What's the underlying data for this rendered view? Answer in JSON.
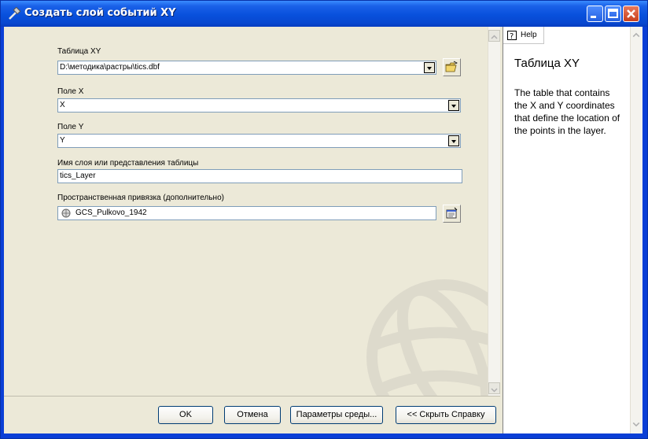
{
  "window": {
    "title": "Создать слой событий  XY"
  },
  "fields": {
    "table_xy": {
      "label": "Таблица XY",
      "value": "D:\\методика\\растры\\tics.dbf"
    },
    "field_x": {
      "label": "Поле X",
      "value": "X"
    },
    "field_y": {
      "label": "Поле Y",
      "value": "Y"
    },
    "layer_name": {
      "label": "Имя слоя или представления таблицы",
      "value": "tics_Layer"
    },
    "spatial_ref": {
      "label": "Пространственная привязка (дополнительно)",
      "value": "GCS_Pulkovo_1942"
    }
  },
  "buttons": {
    "ok": "OK",
    "cancel": "Отмена",
    "env": "Параметры среды...",
    "hide_help": "<< Скрыть Справку"
  },
  "help": {
    "tab_label": "Help",
    "title": "Таблица XY",
    "body": "The table that contains the X and Y coordinates that define the location of the points in the layer."
  },
  "icons": {
    "title": "hammer-icon",
    "browse": "folder-open-icon",
    "spatial_props": "properties-icon",
    "globe": "globe-icon",
    "help": "help-icon"
  }
}
